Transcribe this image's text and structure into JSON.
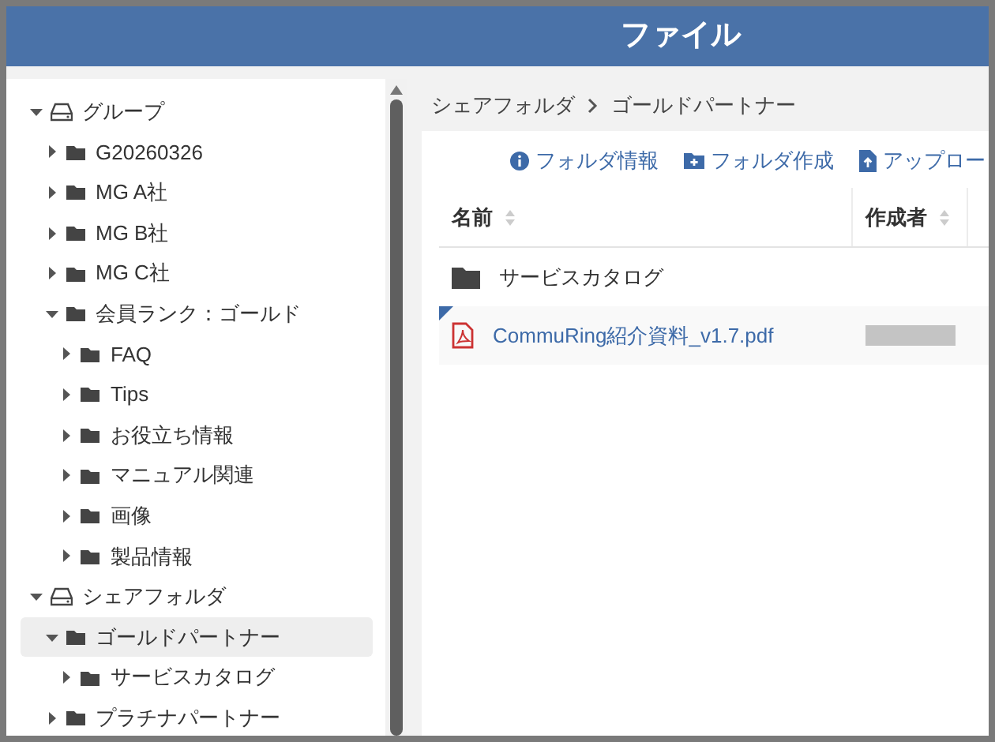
{
  "header": {
    "title": "ファイル"
  },
  "sidebar": {
    "tree": [
      {
        "label": "グループ",
        "kind": "drive",
        "expanded": true,
        "selected": false,
        "children": [
          {
            "label": "G20260326",
            "kind": "folder",
            "expanded": false,
            "selected": false
          },
          {
            "label": "MG A社",
            "kind": "folder",
            "expanded": false,
            "selected": false
          },
          {
            "label": "MG B社",
            "kind": "folder",
            "expanded": false,
            "selected": false
          },
          {
            "label": "MG C社",
            "kind": "folder",
            "expanded": false,
            "selected": false
          },
          {
            "label": "会員ランク：ゴールド",
            "kind": "folder",
            "expanded": true,
            "selected": false,
            "children": [
              {
                "label": "FAQ",
                "kind": "folder",
                "expanded": false,
                "selected": false
              },
              {
                "label": "Tips",
                "kind": "folder",
                "expanded": false,
                "selected": false
              },
              {
                "label": "お役立ち情報",
                "kind": "folder",
                "expanded": false,
                "selected": false
              },
              {
                "label": "マニュアル関連",
                "kind": "folder",
                "expanded": false,
                "selected": false
              },
              {
                "label": "画像",
                "kind": "folder",
                "expanded": false,
                "selected": false
              },
              {
                "label": "製品情報",
                "kind": "folder",
                "expanded": false,
                "selected": false
              }
            ]
          }
        ]
      },
      {
        "label": "シェアフォルダ",
        "kind": "drive",
        "expanded": true,
        "selected": false,
        "children": [
          {
            "label": "ゴールドパートナー",
            "kind": "folder",
            "expanded": true,
            "selected": true,
            "children": [
              {
                "label": "サービスカタログ",
                "kind": "folder",
                "expanded": false,
                "selected": false
              }
            ]
          },
          {
            "label": "プラチナパートナー",
            "kind": "folder",
            "expanded": false,
            "selected": false
          }
        ]
      }
    ]
  },
  "breadcrumb": [
    "シェアフォルダ",
    "ゴールドパートナー"
  ],
  "toolbar": [
    {
      "label": "フォルダ情報",
      "kind": "info"
    },
    {
      "label": "フォルダ作成",
      "kind": "new-folder"
    },
    {
      "label": "アップロー",
      "kind": "upload"
    }
  ],
  "table": {
    "columns": [
      "名前",
      "作成者"
    ],
    "rows": [
      {
        "kind": "folder",
        "name": "サービスカタログ",
        "author_redacted": false,
        "new": false
      },
      {
        "kind": "pdf",
        "name": "CommuRing紹介資料_v1.7.pdf",
        "author_redacted": true,
        "new": true
      }
    ]
  }
}
